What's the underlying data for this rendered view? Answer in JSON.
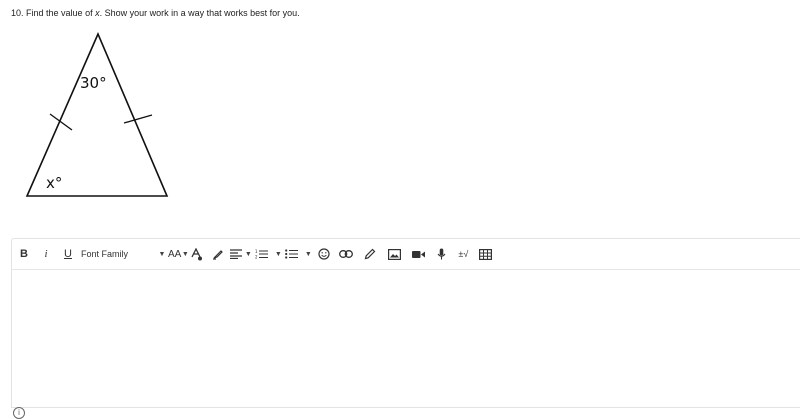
{
  "question": {
    "number": "10.",
    "text_before": "Find the value of ",
    "variable": "x",
    "text_after": ".  Show your work in a way that works best for you."
  },
  "figure": {
    "top_angle_label": "30°",
    "bottom_angle_label": "x°"
  },
  "toolbar": {
    "bold_label": "B",
    "italic_label": "i",
    "underline_label": "U",
    "font_family_label": "Font Family",
    "font_size_label": "AA",
    "equation_label": "±√"
  }
}
